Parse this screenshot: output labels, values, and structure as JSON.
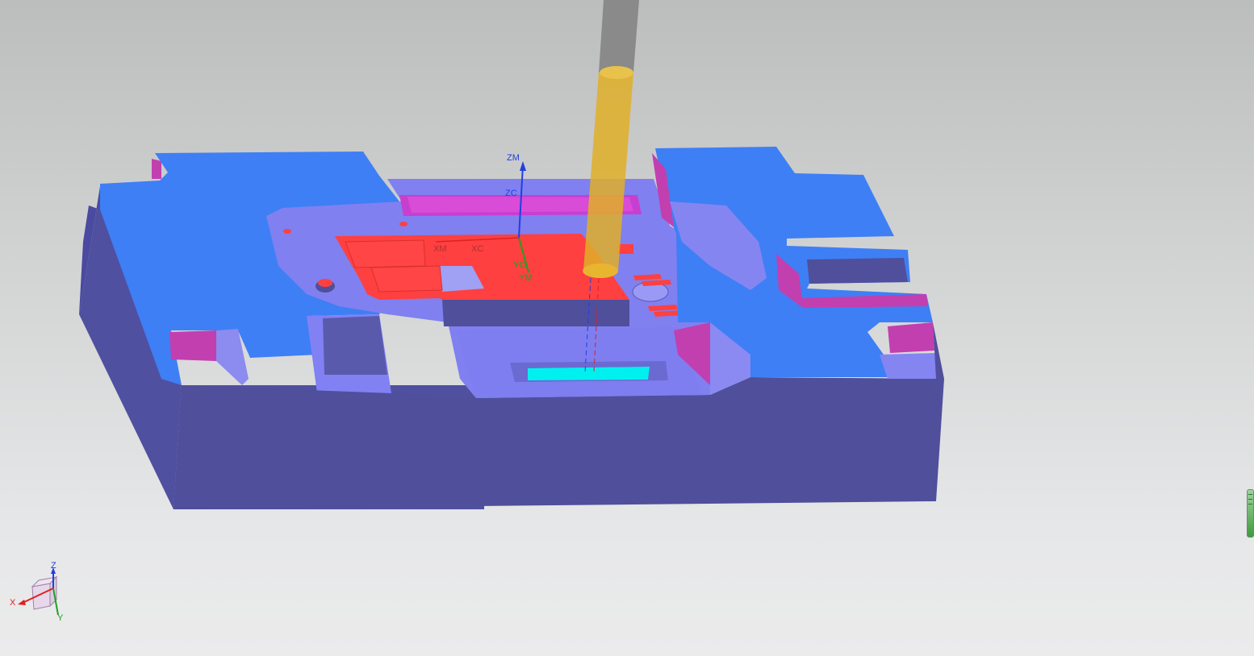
{
  "viewport": {
    "background": [
      "#bcbdbd",
      "#ebebec"
    ]
  },
  "model": {
    "colors": {
      "top_face": "#3e7ff5",
      "side_face": "#4f4f9c",
      "pocket_floor": "#8080f0",
      "wall_magenta": "#c23fb0",
      "selected_red": "#ff4040",
      "cyan_face": "#00f0f0",
      "tool_holder": "#8c8c8c",
      "tool_cutter": "#e1b029"
    }
  },
  "csys": {
    "zm": "ZM",
    "zc": "ZC",
    "xm": "XM",
    "xc": "XC",
    "yc": "YC",
    "ym": "YM"
  },
  "triad": {
    "x": "X",
    "y": "Y",
    "z": "Z"
  }
}
